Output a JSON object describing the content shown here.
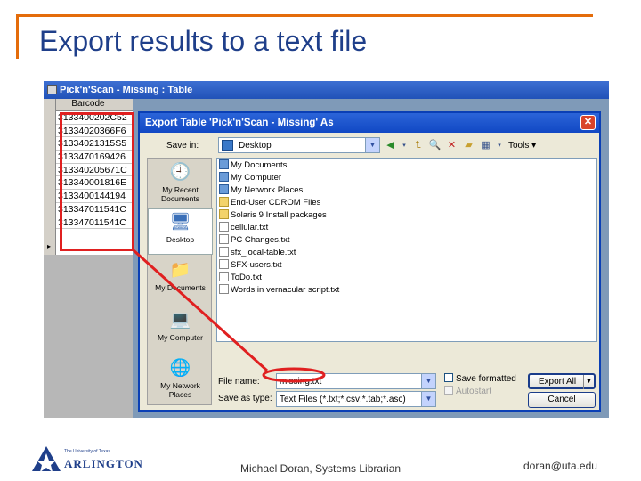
{
  "slide": {
    "title": "Export results to a text file",
    "footer_center": "Michael Doran, Systems Librarian",
    "footer_right": "doran@uta.edu",
    "logo_small": "The University of Texas",
    "logo_big": "ARLINGTON",
    "accent_color": "#e46c0a",
    "title_color": "#1f3f8a"
  },
  "table_window": {
    "title": "Pick'n'Scan - Missing : Table",
    "column_header": "Barcode",
    "rows": [
      "3133400202C52",
      "31334020366F6",
      "31334021315S5",
      "3133470169426",
      "313340205671C",
      "313340001816E",
      "3133400144194",
      "313347011541C",
      "313347011541C"
    ],
    "record_pointer": "▸"
  },
  "dialog": {
    "title": "Export Table 'Pick'n'Scan - Missing' As",
    "close_glyph": "✕",
    "save_in_label": "Save in:",
    "save_in_value": "Desktop",
    "tools_label": "Tools ▾",
    "places": [
      {
        "label": "My Recent Documents",
        "icon": "recent-documents-icon"
      },
      {
        "label": "Desktop",
        "icon": "desktop-icon"
      },
      {
        "label": "My Documents",
        "icon": "my-documents-icon"
      },
      {
        "label": "My Computer",
        "icon": "my-computer-icon"
      },
      {
        "label": "My Network Places",
        "icon": "network-places-icon"
      }
    ],
    "files": [
      {
        "name": "My Documents",
        "kind": "special"
      },
      {
        "name": "My Computer",
        "kind": "special"
      },
      {
        "name": "My Network Places",
        "kind": "special"
      },
      {
        "name": "End-User CDROM Files",
        "kind": "folder"
      },
      {
        "name": "Solaris 9 Install packages",
        "kind": "folder"
      },
      {
        "name": "cellular.txt",
        "kind": "doc"
      },
      {
        "name": "PC Changes.txt",
        "kind": "doc"
      },
      {
        "name": "sfx_local-table.txt",
        "kind": "doc"
      },
      {
        "name": "SFX-users.txt",
        "kind": "doc"
      },
      {
        "name": "ToDo.txt",
        "kind": "doc"
      },
      {
        "name": "Words in vernacular script.txt",
        "kind": "doc"
      }
    ],
    "file_name_label": "File name:",
    "file_name_value": "missing.txt",
    "save_as_type_label": "Save as type:",
    "save_as_type_value": "Text Files (*.txt;*.csv;*.tab;*.asc)",
    "save_formatted_label": "Save formatted",
    "autostart_label": "Autostart",
    "export_all_label": "Export All",
    "cancel_label": "Cancel"
  },
  "annotation": {
    "arrow_color": "#e02020"
  }
}
